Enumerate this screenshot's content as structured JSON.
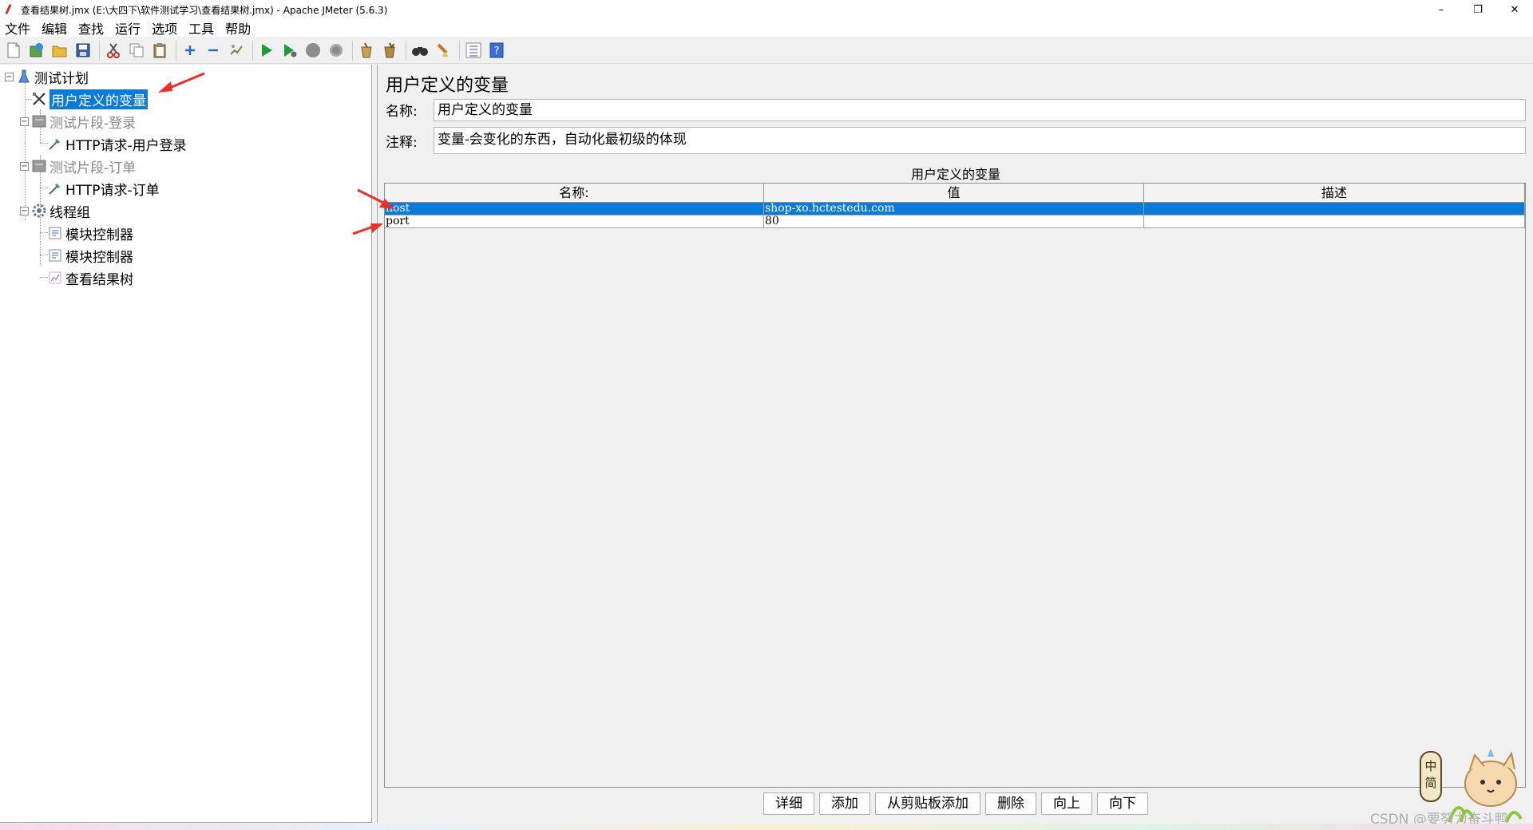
{
  "window": {
    "title": "查看结果树.jmx (E:\\大四下\\软件测试学习\\查看结果树.jmx) - Apache JMeter (5.6.3)",
    "minimize": "–",
    "maximize": "❐",
    "close": "✕"
  },
  "menu": [
    "文件",
    "编辑",
    "查找",
    "运行",
    "选项",
    "工具",
    "帮助"
  ],
  "toolbar_icons": [
    "new-icon",
    "templates-icon",
    "open-icon",
    "save-icon",
    "cut-icon",
    "copy-icon",
    "paste-icon",
    "expand-icon",
    "collapse-icon",
    "toggle-icon",
    "start-icon",
    "start-no-pause-icon",
    "stop-icon",
    "shutdown-icon",
    "clear-icon",
    "clear-all-icon",
    "search-icon",
    "reset-search-icon",
    "function-helper-icon",
    "help-icon"
  ],
  "tree": {
    "items": [
      {
        "label": "测试计划",
        "icon": "test-plan-icon",
        "state": "normal"
      },
      {
        "label": "用户定义的变量",
        "icon": "tools-icon",
        "state": "selected"
      },
      {
        "label": "测试片段-登录",
        "icon": "fragment-icon",
        "state": "disabled"
      },
      {
        "label": "HTTP请求-用户登录",
        "icon": "pipette-icon",
        "state": "normal"
      },
      {
        "label": "测试片段-订单",
        "icon": "fragment-icon",
        "state": "disabled"
      },
      {
        "label": "HTTP请求-订单",
        "icon": "pipette-icon",
        "state": "normal"
      },
      {
        "label": "线程组",
        "icon": "gear-icon",
        "state": "normal"
      },
      {
        "label": "模块控制器",
        "icon": "module-icon",
        "state": "normal"
      },
      {
        "label": "模块控制器",
        "icon": "module-icon",
        "state": "normal"
      },
      {
        "label": "查看结果树",
        "icon": "chart-icon",
        "state": "normal"
      }
    ]
  },
  "panel": {
    "title": "用户定义的变量",
    "name_label": "名称:",
    "name_value": "用户定义的变量",
    "comment_label": "注释:",
    "comment_value": "变量-会变化的东西，自动化最初级的体现",
    "table_caption": "用户定义的变量",
    "columns": [
      "名称:",
      "值",
      "描述"
    ],
    "rows": [
      {
        "name": "host",
        "value": "shop-xo.hctestedu.com",
        "desc": ""
      },
      {
        "name": "port",
        "value": "80",
        "desc": ""
      }
    ],
    "buttons": [
      "详细",
      "添加",
      "从剪贴板添加",
      "删除",
      "向上",
      "向下"
    ]
  },
  "watermark": {
    "text": "CSDN @要努力奋斗鸭",
    "badge_top": "中",
    "badge_bottom": "简"
  },
  "colors": {
    "selection": "#0a7bd6",
    "annotation_arrow": "#e8302a"
  }
}
